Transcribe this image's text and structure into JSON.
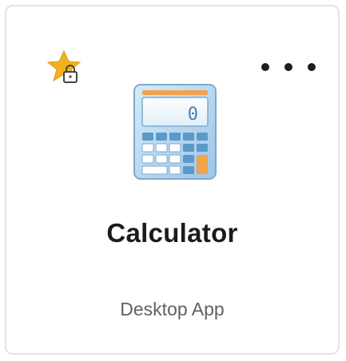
{
  "tile": {
    "title": "Calculator",
    "subtitle": "Desktop App",
    "badge_icon": "favorite-star-lock-icon",
    "menu_icon": "more-options-icon",
    "app_icon": "calculator-icon",
    "calculator_display": "0",
    "colors": {
      "star": "#f2b21b",
      "lock": "#444444",
      "calculator_body": "#b9d8ef",
      "calculator_display": "#ffffff",
      "calculator_keys": "#5b9ac8",
      "text_title": "#1b1b1b",
      "text_subtitle": "#616161",
      "border": "#e3e3e3"
    }
  }
}
